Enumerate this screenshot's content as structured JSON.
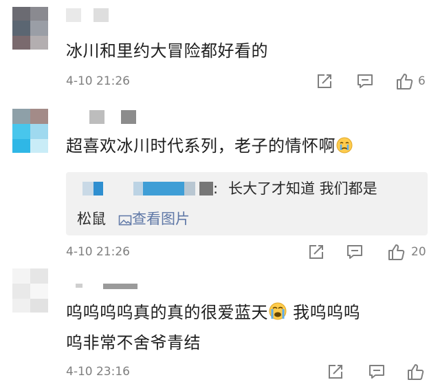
{
  "comments": [
    {
      "text": "冰川和里约大冒险都好看的",
      "time": "4-10 21:26",
      "likes": "6"
    },
    {
      "text": "超喜欢冰川时代系列，老子的情怀啊",
      "emoji": "crying-face",
      "time": "4-10 21:26",
      "likes": "20",
      "reply": {
        "text": "长大了才知道 我们都是",
        "text2": "松鼠",
        "link": "查看图片"
      }
    },
    {
      "text_before": "呜呜呜呜真的真的很爱蓝天",
      "emoji": "loudly-crying-face",
      "text_after": " 我呜呜呜",
      "text_line2": "呜非常不舍爷青结",
      "time": "4-10 23:16"
    }
  ],
  "colors": {
    "meta_text": "#7f7f7f",
    "link": "#5e77a6",
    "quote_bg": "#f1f1f1"
  }
}
